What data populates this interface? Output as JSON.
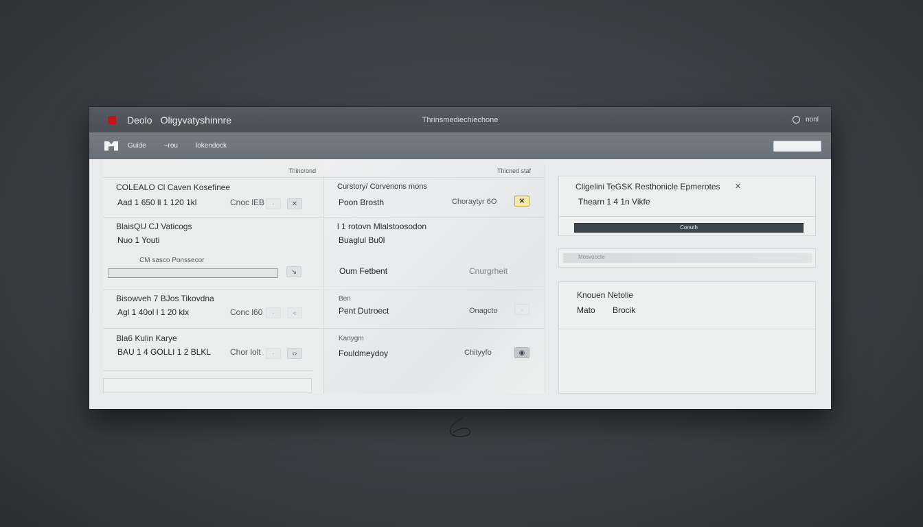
{
  "window": {
    "app_name": "Deolo",
    "doc_name": "Oligyvatyshinnre",
    "center_title": "Thrinsmediechiechone",
    "right_label": "nonl"
  },
  "toolbar": {
    "items": [
      "Guide",
      "~rou",
      "lokendock"
    ]
  },
  "column_labels": {
    "left": "Thincrond",
    "mid": "Thicned staf"
  },
  "left_rows": [
    {
      "title": "COLEALO Cl Caven Kosefinee",
      "sub": "Aad 1 650 ll 1 120 1kl",
      "meta": "Cnoc lEB",
      "btn1": "·",
      "btn2": "✕"
    },
    {
      "title": "BlaisQU CJ Vaticogs",
      "sub": "Nuo 1 Youti"
    },
    {
      "title": "Bisowveh 7 BJos Tikovdna",
      "sub": "Agl 1 40ol l 1 20 klx",
      "meta": "Conc l60",
      "btn1": "·",
      "btn2": "«"
    },
    {
      "title": "Bla6 Kulin Karye",
      "sub": "BAU 1 4 GOLLI 1 2 BLKL",
      "meta": "Chor lolt",
      "btn1": "·",
      "btn2": "‹›"
    }
  ],
  "left_field": {
    "label": "CM sasco Ponssecor",
    "btn": "↘"
  },
  "mid_rows": [
    {
      "title": "Curstory/ Corvenons mons",
      "sub": "Poon Brosth",
      "meta": "Choraytyr 6O",
      "btn": "✕"
    },
    {
      "title": "l 1 rotovn Mlalstoosodon",
      "sub": "Buaglul Bu0l"
    },
    {
      "sub": "Oum Fetbent",
      "meta": "Cnurgrheit"
    },
    {
      "title": "Ben",
      "sub": "Pent Dutroect",
      "meta": "Onagcto",
      "btn": "·"
    },
    {
      "title": "Kanygm",
      "sub": "Fouldmeydoy",
      "meta": "Chityyfo",
      "btn": "◉"
    }
  ],
  "right_panel": {
    "title": "Cligelini TeGSK Resthonicle Epmerotes",
    "close": "✕",
    "sub": "Thearn 1 4 1n Vikfe",
    "progress_label": "Conuth",
    "progress_value": 1.0,
    "pill_label": "Mosvoocte",
    "card_title": "Knouen Netolie",
    "card_sub_a": "Mato",
    "card_sub_b": "Brocik"
  }
}
